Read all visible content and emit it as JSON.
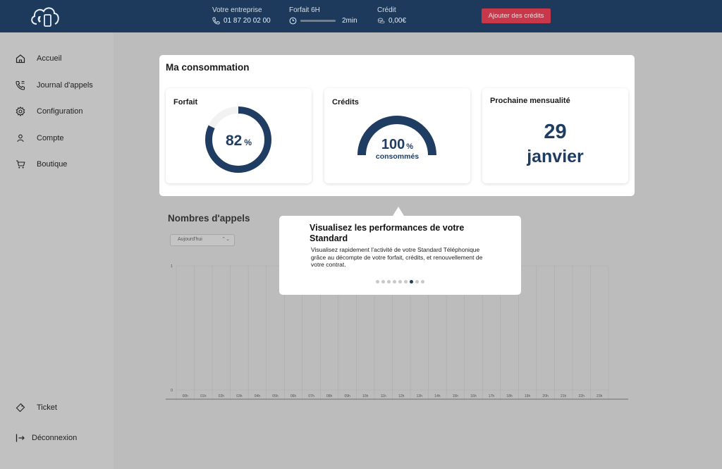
{
  "header": {
    "company_label": "Votre entreprise",
    "phone": "01 87 20 02 00",
    "plan_label": "Forfait 6H",
    "plan_usage": "2min",
    "credit_label": "Crédit",
    "credit_value": "0,00€",
    "add_credits_button": "Ajouter des crédits",
    "colors": {
      "bar": "#1d3a5c",
      "accent": "#c8384a"
    }
  },
  "sidebar": {
    "items": [
      {
        "label": "Accueil",
        "icon": "home-icon"
      },
      {
        "label": "Journal d'appels",
        "icon": "phone-log-icon"
      },
      {
        "label": "Configuration",
        "icon": "gear-icon"
      },
      {
        "label": "Compte",
        "icon": "user-icon"
      },
      {
        "label": "Boutique",
        "icon": "cart-icon"
      }
    ],
    "bottom": [
      {
        "label": "Ticket",
        "icon": "ticket-icon"
      },
      {
        "label": "Déconnexion",
        "icon": "logout-icon"
      }
    ]
  },
  "consumption": {
    "title": "Ma consommation",
    "plan_card": {
      "title": "Forfait",
      "value": "82",
      "unit": "%",
      "fraction": 0.82
    },
    "credits_card": {
      "title": "Crédits",
      "value": "100",
      "unit": "%",
      "caption": "consommés",
      "fraction": 1.0
    },
    "billing_card": {
      "title": "Prochaine mensualité",
      "day": "29",
      "month": "janvier"
    },
    "accent_color": "#1f3d63"
  },
  "calls": {
    "title": "Nombres d'appels",
    "period_select": "Aujourd'hui",
    "y_ticks": [
      "1",
      "0"
    ],
    "hours": [
      "00h",
      "01h",
      "02h",
      "03h",
      "04h",
      "05h",
      "06h",
      "07h",
      "08h",
      "09h",
      "10h",
      "11h",
      "12h",
      "13h",
      "14h",
      "15h",
      "16h",
      "17h",
      "18h",
      "19h",
      "20h",
      "21h",
      "22h",
      "23h"
    ]
  },
  "tooltip": {
    "title": "Visualisez les performances de votre Standard",
    "body": "Visualisez rapidement l’activité de votre Standard Téléphonique grâce au décompte de votre forfait, crédits, et renouvellement de votre contrat.",
    "step_count": 9,
    "active_step": 7
  }
}
